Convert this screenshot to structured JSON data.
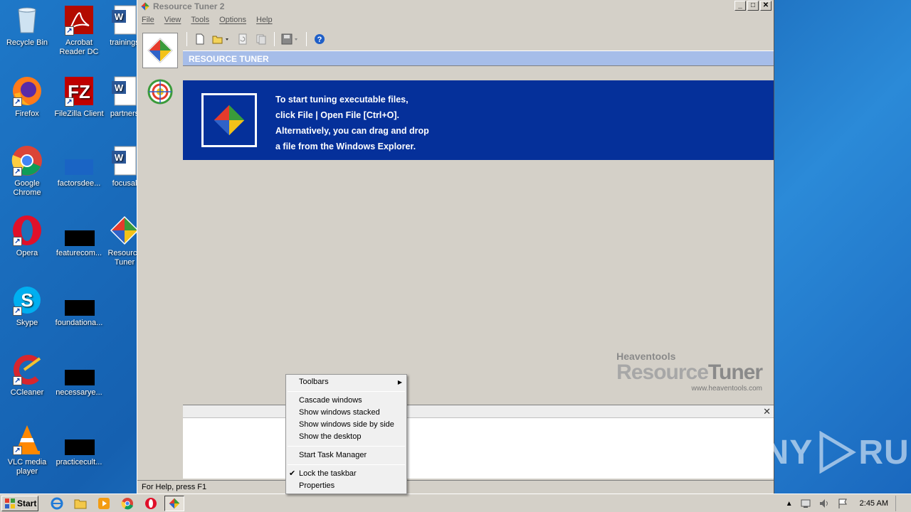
{
  "desktop": {
    "icons": [
      {
        "label": "Recycle Bin",
        "icon": "recycle-bin-icon"
      },
      {
        "label": "Acrobat Reader DC",
        "icon": "acrobat-icon"
      },
      {
        "label": "trainings",
        "icon": "word-doc-icon"
      },
      {
        "label": "Firefox",
        "icon": "firefox-icon"
      },
      {
        "label": "FileZilla Client",
        "icon": "filezilla-icon"
      },
      {
        "label": "partners",
        "icon": "word-doc-icon"
      },
      {
        "label": "Google Chrome",
        "icon": "chrome-icon"
      },
      {
        "label": "factorsdee...",
        "icon": "file-icon"
      },
      {
        "label": "focusal",
        "icon": "word-doc-icon"
      },
      {
        "label": "Opera",
        "icon": "opera-icon"
      },
      {
        "label": "featurecom...",
        "icon": "file-icon"
      },
      {
        "label": "Resource Tuner",
        "icon": "resource-tuner-icon"
      },
      {
        "label": "Skype",
        "icon": "skype-icon"
      },
      {
        "label": "foundationa...",
        "icon": "file-icon"
      },
      {
        "label": "CCleaner",
        "icon": "ccleaner-icon"
      },
      {
        "label": "necessarye...",
        "icon": "file-icon"
      },
      {
        "label": "VLC media player",
        "icon": "vlc-icon"
      },
      {
        "label": "practicecult...",
        "icon": "file-icon"
      }
    ]
  },
  "window": {
    "title": "Resource Tuner 2",
    "menu": [
      "File",
      "View",
      "Tools",
      "Options",
      "Help"
    ],
    "section_header": "RESOURCE TUNER",
    "welcome_lines": [
      "To start tuning executable files,",
      "click File | Open File [Ctrl+O].",
      "Alternatively, you can drag and drop",
      "a file from the Windows Explorer."
    ],
    "branding": {
      "company": "Heaventools",
      "product_a": "Resource",
      "product_b": "Tuner",
      "url": "www.heaventools.com"
    },
    "status": "For Help, press F1"
  },
  "context_menu": {
    "items": [
      {
        "label": "Toolbars",
        "submenu": true
      },
      {
        "label": "Cascade windows"
      },
      {
        "label": "Show windows stacked"
      },
      {
        "label": "Show windows side by side"
      },
      {
        "label": "Show the desktop"
      },
      {
        "label": "Start Task Manager"
      },
      {
        "label": "Lock the taskbar",
        "checked": true
      },
      {
        "label": "Properties"
      }
    ]
  },
  "taskbar": {
    "start_label": "Start",
    "clock": "2:45 AM"
  },
  "watermark": {
    "text_a": "ANY",
    "text_b": "RUN"
  }
}
